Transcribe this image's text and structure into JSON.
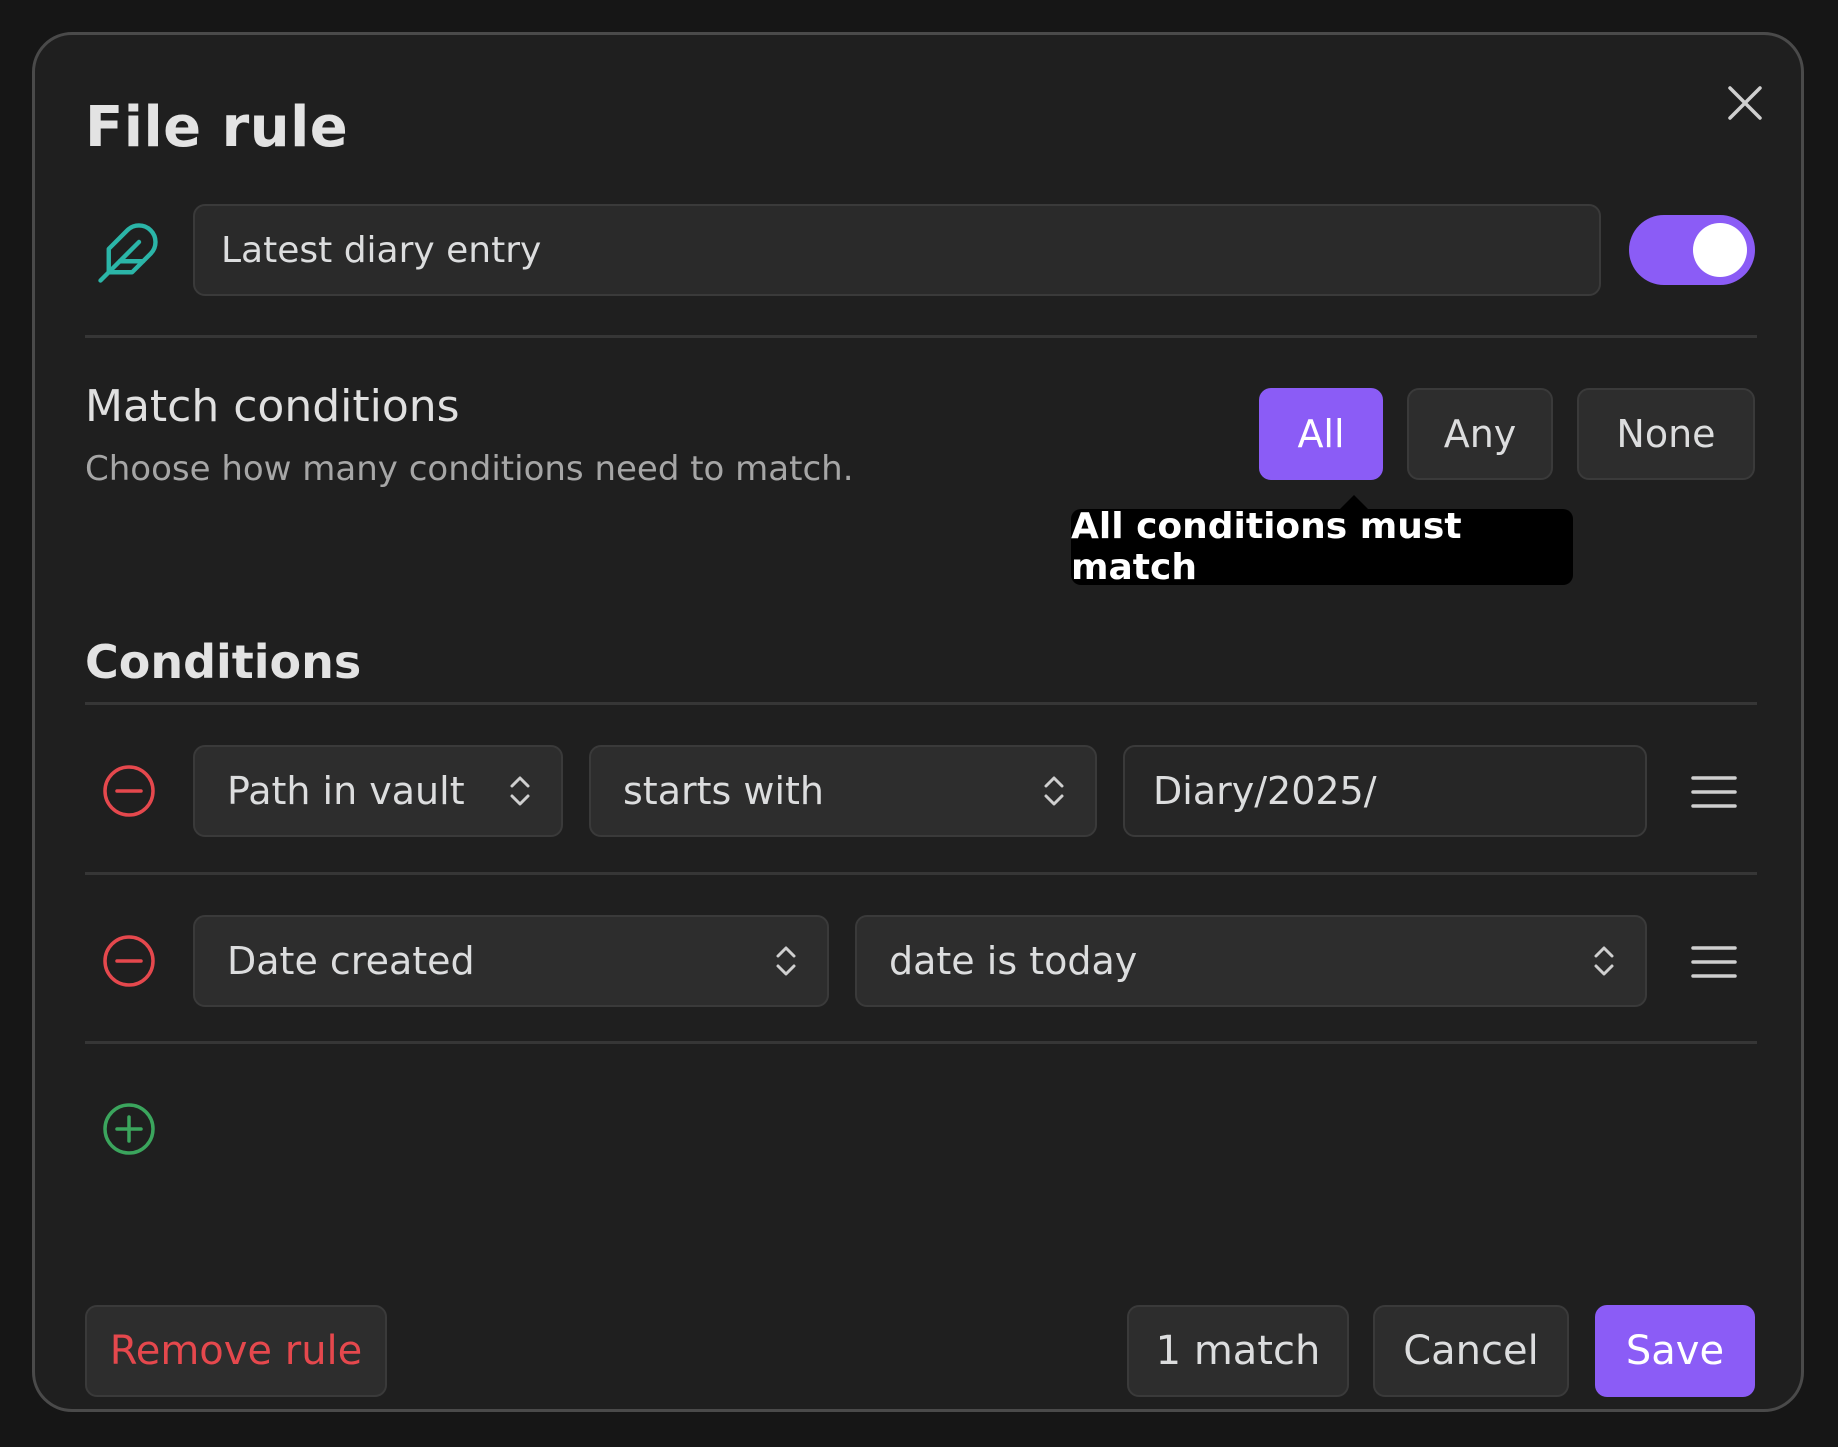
{
  "modal": {
    "title": "File rule",
    "close_icon": "close-icon"
  },
  "rule": {
    "icon": "feather-icon",
    "name": "Latest diary entry",
    "enabled": true
  },
  "match": {
    "heading": "Match conditions",
    "description": "Choose how many conditions need to match.",
    "options": [
      "All",
      "Any",
      "None"
    ],
    "selected": "All",
    "tooltip": "All conditions must match"
  },
  "conditions": {
    "heading": "Conditions",
    "rows": [
      {
        "field": "Path in vault",
        "operator": "starts with",
        "value": "Diary/2025/"
      },
      {
        "field": "Date created",
        "operator": "date is today"
      }
    ],
    "add_icon": "add-circle-icon",
    "remove_icon": "remove-circle-icon",
    "drag_icon": "drag-handle-icon"
  },
  "footer": {
    "remove_label": "Remove rule",
    "matches_label": "1 match",
    "cancel_label": "Cancel",
    "save_label": "Save"
  },
  "colors": {
    "accent": "#8b5cf6",
    "danger": "#e5484d",
    "success": "#3ba55d",
    "feather": "#2bb5a8"
  }
}
